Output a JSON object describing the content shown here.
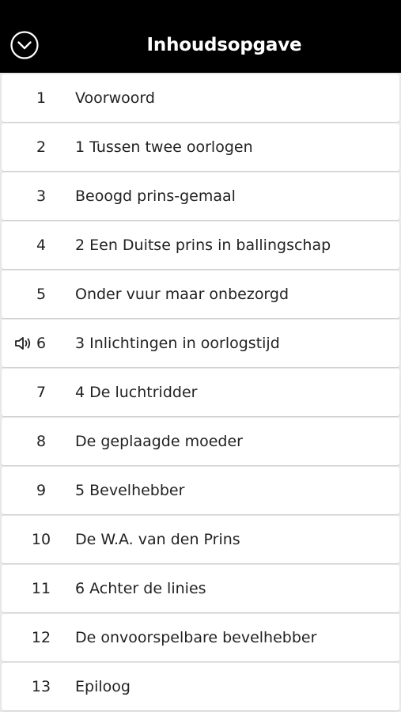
{
  "header": {
    "title": "Inhoudsopgave",
    "back_icon": "chevron-down-circle-icon"
  },
  "toc": {
    "playing_icon": "speaker-icon",
    "items": [
      {
        "number": "1",
        "label": "Voorwoord"
      },
      {
        "number": "2",
        "label": "1 Tussen twee oorlogen"
      },
      {
        "number": "3",
        "label": "Beoogd prins-gemaal"
      },
      {
        "number": "4",
        "label": "2 Een Duitse prins in ballingschap"
      },
      {
        "number": "5",
        "label": "Onder vuur maar onbezorgd"
      },
      {
        "number": "6",
        "label": "3 Inlichtingen in oorlogstijd",
        "playing": true
      },
      {
        "number": "7",
        "label": "4 De luchtridder"
      },
      {
        "number": "8",
        "label": "De geplaagde moeder"
      },
      {
        "number": "9",
        "label": "5 Bevelhebber"
      },
      {
        "number": "10",
        "label": "De W.A. van den Prins"
      },
      {
        "number": "11",
        "label": "6 Achter de linies"
      },
      {
        "number": "12",
        "label": "De onvoorspelbare bevelhebber"
      },
      {
        "number": "13",
        "label": "Epiloog"
      }
    ]
  },
  "colors": {
    "header_bg": "#000000",
    "header_text": "#ffffff",
    "list_bg": "#e9e9e9",
    "row_bg": "#ffffff",
    "row_text": "#222222"
  }
}
